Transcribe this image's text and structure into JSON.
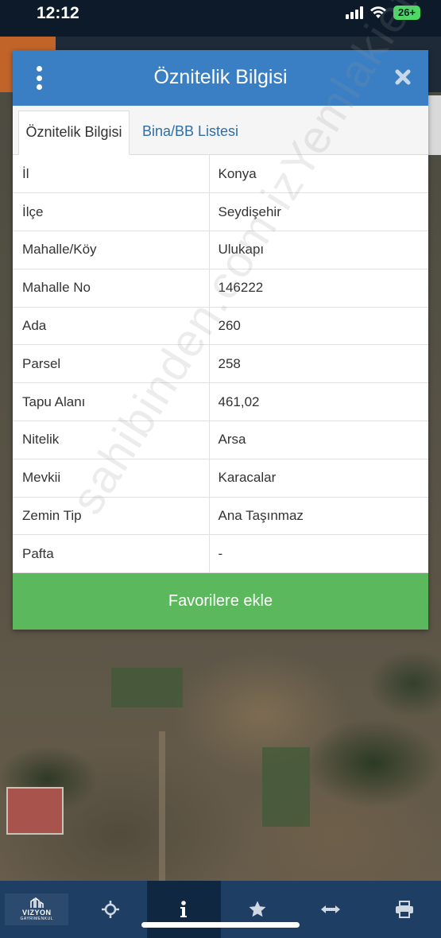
{
  "status_bar": {
    "time": "12:12",
    "battery": "26+"
  },
  "modal": {
    "title": "Öznitelik Bilgisi",
    "tabs": [
      {
        "label": "Öznitelik Bilgisi",
        "active": true
      },
      {
        "label": "Bina/BB Listesi",
        "active": false
      }
    ],
    "rows": [
      {
        "key": "İl",
        "value": "Konya"
      },
      {
        "key": "İlçe",
        "value": "Seydişehir"
      },
      {
        "key": "Mahalle/Köy",
        "value": "Ulukapı"
      },
      {
        "key": "Mahalle No",
        "value": "146222"
      },
      {
        "key": "Ada",
        "value": "260"
      },
      {
        "key": "Parsel",
        "value": "258"
      },
      {
        "key": "Tapu Alanı",
        "value": "461,02"
      },
      {
        "key": "Nitelik",
        "value": "Arsa"
      },
      {
        "key": "Mevkii",
        "value": "Karacalar"
      },
      {
        "key": "Zemin Tip",
        "value": "Ana Taşınmaz"
      },
      {
        "key": "Pafta",
        "value": "-"
      }
    ],
    "favorite_button": "Favorilere ekle"
  },
  "watermark": "sahibinden.com izYemlakiet.com",
  "bottom_nav": {
    "logo_text": "VIZYON",
    "logo_sub": "GAYRIMENKUL",
    "items": [
      {
        "icon": "logo-icon",
        "active": false
      },
      {
        "icon": "crosshair-icon",
        "active": false
      },
      {
        "icon": "info-icon",
        "active": true
      },
      {
        "icon": "star-icon",
        "active": false
      },
      {
        "icon": "measure-icon",
        "active": false
      },
      {
        "icon": "print-icon",
        "active": false
      }
    ]
  },
  "colors": {
    "header": "#3a7fc4",
    "button": "#5cb85c",
    "nav": "#1e3e63"
  }
}
